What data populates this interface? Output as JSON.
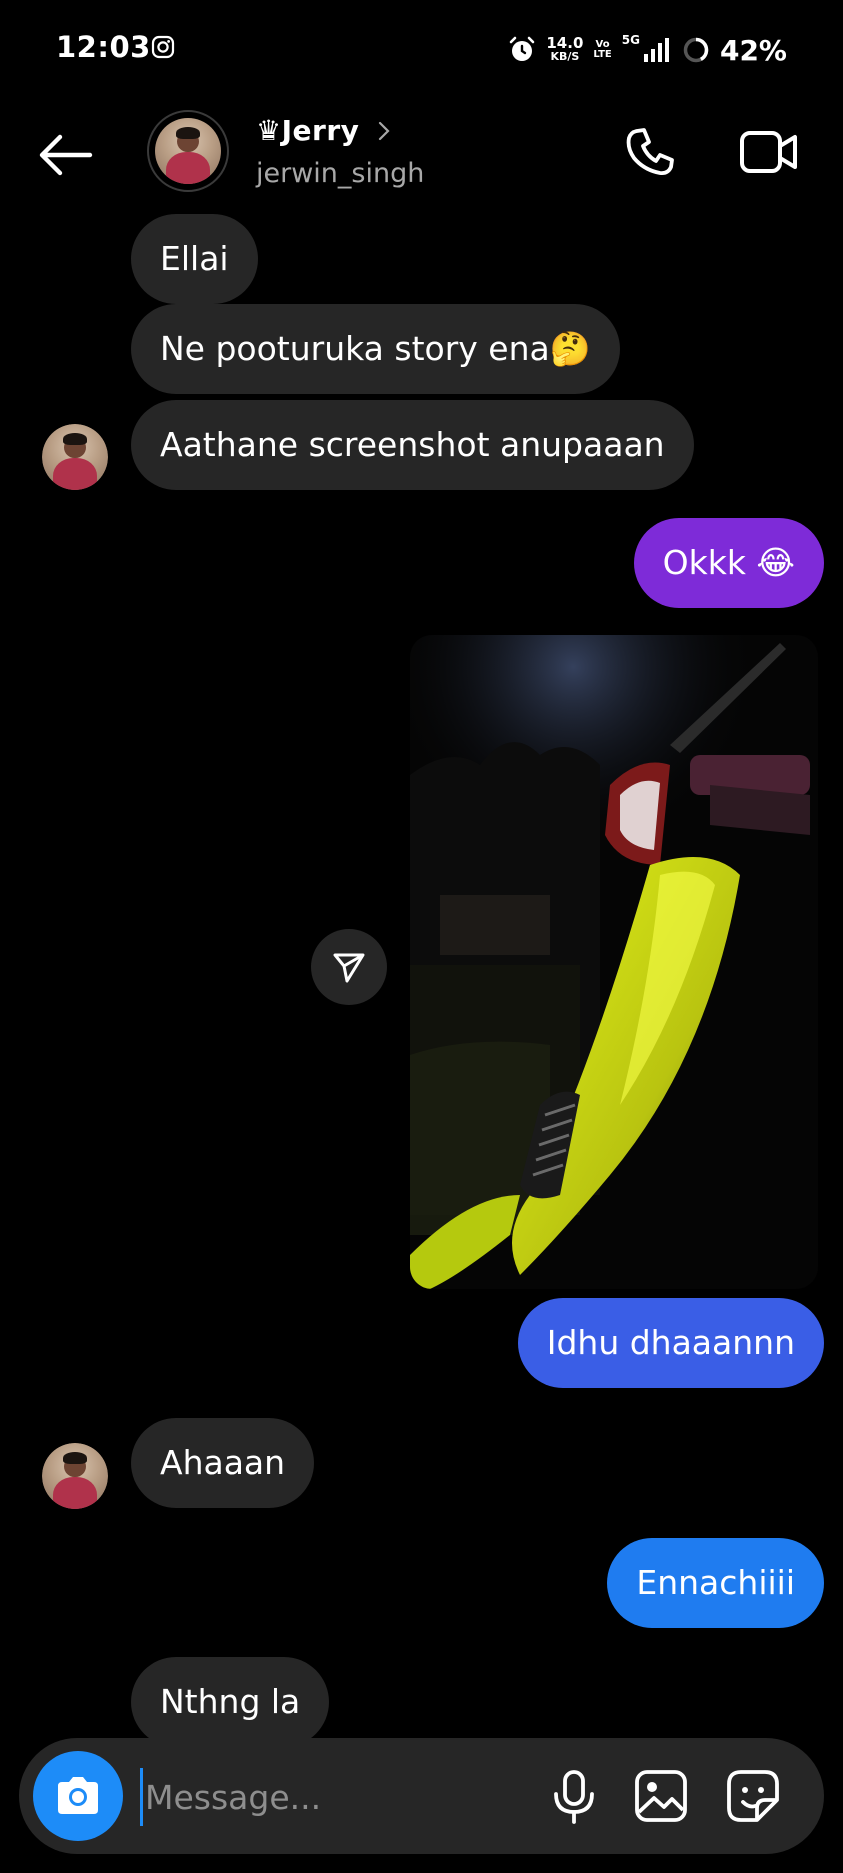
{
  "status_bar": {
    "time": "12:03",
    "net_speed": "14.0",
    "net_speed_unit": "KB/S",
    "volte_top": "Vo",
    "volte_bottom": "LTE",
    "network_type": "5G",
    "battery": "42%"
  },
  "header": {
    "display_name": "♛Jerry",
    "username": "jerwin_singh"
  },
  "colors": {
    "background": "#000000",
    "incoming_bubble": "#262626",
    "outgoing_purple": "#7e2bd8",
    "outgoing_blue_1": "#3a5ee6",
    "outgoing_blue_2": "#1f7cf0",
    "accent_blue": "#1d8cf8"
  },
  "messages": [
    {
      "text": "Ellai",
      "direction": "incoming"
    },
    {
      "text": "Ne pooturuka story ena🤔",
      "direction": "incoming"
    },
    {
      "text": "Aathane screenshot anupaaan",
      "direction": "incoming"
    },
    {
      "text": "Okkk 😂",
      "direction": "outgoing"
    },
    {
      "text": "Idhu dhaaannn",
      "direction": "outgoing"
    },
    {
      "text": "Ahaaan",
      "direction": "incoming"
    },
    {
      "text": "Ennachiiii",
      "direction": "outgoing"
    },
    {
      "text": "Nthng la",
      "direction": "incoming"
    }
  ],
  "composer": {
    "placeholder": "Message..."
  },
  "icons": {
    "back": "arrow-left-icon",
    "call": "phone-icon",
    "video": "video-camera-icon",
    "share": "paper-plane-icon",
    "camera": "camera-icon",
    "mic": "microphone-icon",
    "gallery": "image-icon",
    "sticker": "sticker-icon"
  }
}
